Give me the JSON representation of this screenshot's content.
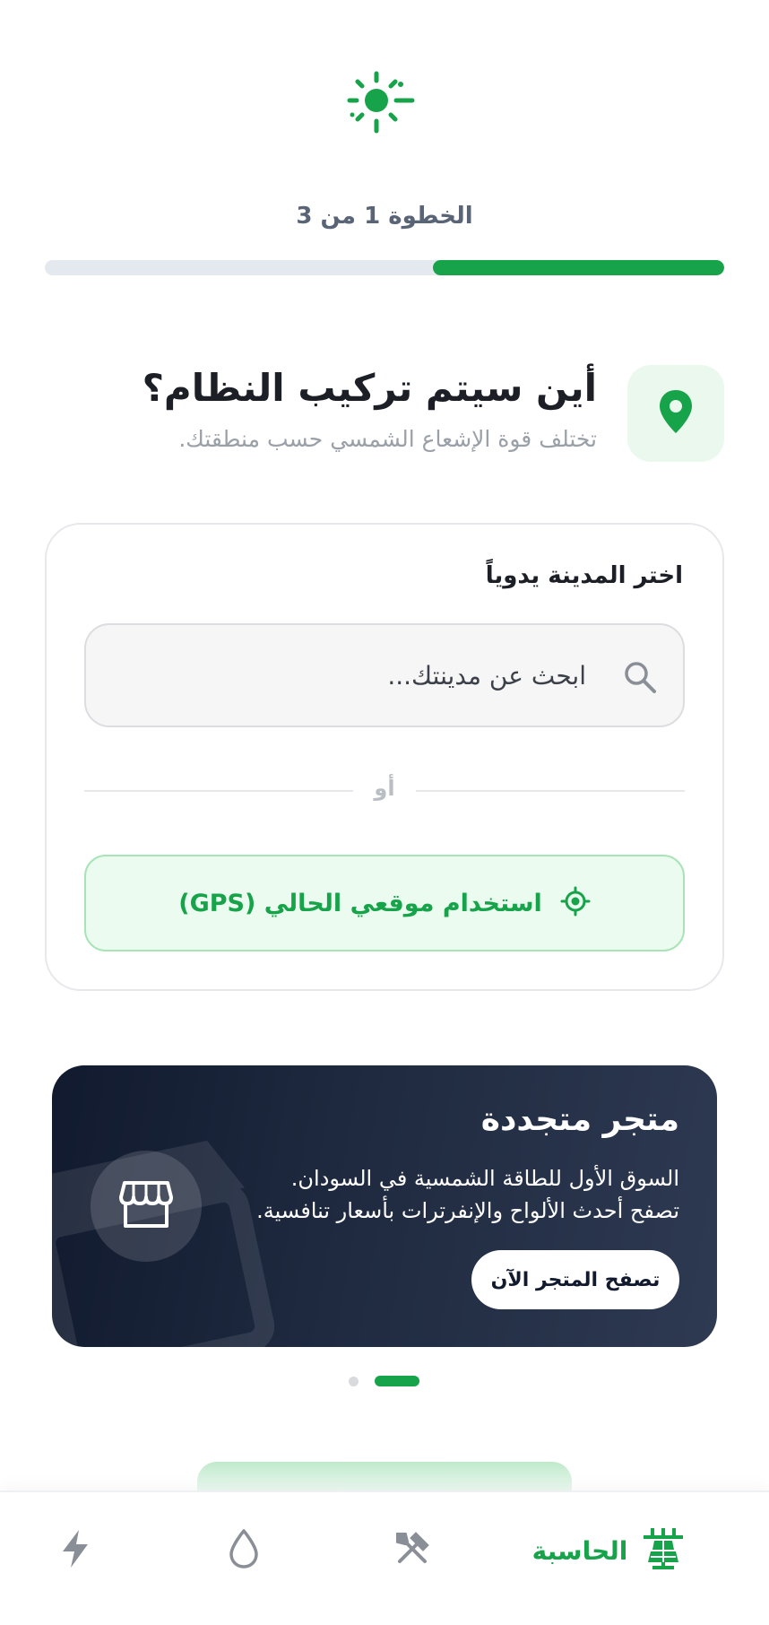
{
  "header": {
    "logo_icon": "sun-sparkle-icon",
    "step_text": "الخطوة 1 من 3",
    "progress": 0.4286,
    "colors": {
      "accent": "#17a34a",
      "track": "#e4e8ef"
    }
  },
  "section": {
    "icon": "location-pin-icon",
    "title": "أين سيتم تركيب النظام؟",
    "subtitle": "تختلف قوة الإشعاع الشمسي حسب منطقتك."
  },
  "city_card": {
    "label": "اختر المدينة يدوياً",
    "search": {
      "icon": "search-icon",
      "placeholder": "ابحث عن مدينتك...",
      "value": ""
    },
    "or_text": "أو",
    "gps_button": {
      "icon": "crosshair-icon",
      "label": "استخدام موقعي الحالي (GPS)"
    }
  },
  "promo": {
    "title": "متجر متجددة",
    "line1": "السوق الأول للطاقة الشمسية في السودان.",
    "line2": "تصفح أحدث الألواح والإنفرترات بأسعار تنافسية.",
    "button_label": "تصفح المتجر الآن",
    "icon": "store-icon",
    "colors": {
      "bg_start": "#111a2e",
      "bg_end": "#2e3a52"
    }
  },
  "carousel": {
    "count": 2,
    "active_index": 1
  },
  "bottom_nav": {
    "items": [
      {
        "label": "الحاسبة",
        "icon": "solar-panel-icon",
        "active": true
      },
      {
        "label": "",
        "icon": "tools-icon",
        "active": false
      },
      {
        "label": "",
        "icon": "water-drop-icon",
        "active": false
      },
      {
        "label": "",
        "icon": "lightning-icon",
        "active": false
      }
    ]
  }
}
